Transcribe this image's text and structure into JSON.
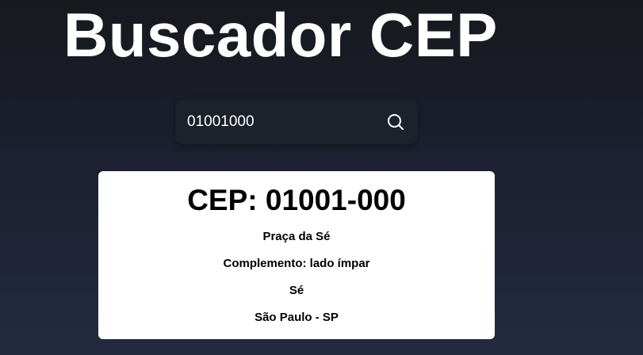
{
  "app": {
    "title": "Buscador CEP"
  },
  "search": {
    "value": "01001000",
    "placeholder": "",
    "button_icon": "search-icon"
  },
  "result": {
    "heading": "CEP: 01001-000",
    "logradouro": "Praça da Sé",
    "complemento": "Complemento: lado ímpar",
    "bairro": "Sé",
    "cidade_uf": "São Paulo - SP"
  },
  "colors": {
    "background_top": "#17191e",
    "background_bottom": "#232b40",
    "search_bg": "#1d212b",
    "card_bg": "#ffffff",
    "title_text": "#ffffff"
  }
}
